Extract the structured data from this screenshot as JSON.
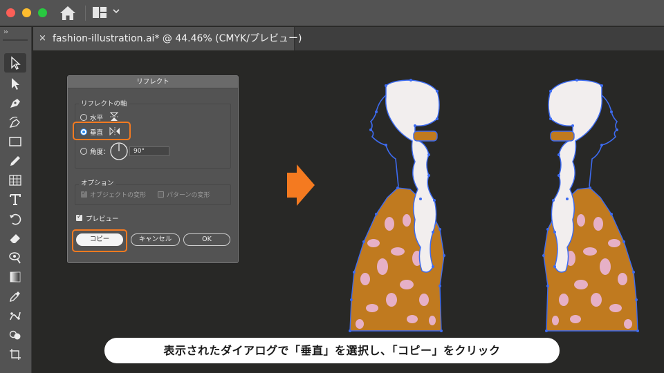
{
  "window": {
    "tab_close_glyph": "×",
    "tab_title": "fashion-illustration.ai* @ 44.46% (CMYK/プレビュー)"
  },
  "toolbar": {
    "collapse_glyph": "››",
    "tools": [
      "selection-tool",
      "direct-selection-tool",
      "pen-tool",
      "curvature-tool",
      "rectangle-tool",
      "pencil-tool",
      "grid-tool",
      "type-tool",
      "rotate-tool",
      "eraser-tool",
      "zoom-tool",
      "gradient-tool",
      "eyedropper-tool",
      "puppet-warp-tool",
      "shape-builder-tool",
      "artboard-tool"
    ]
  },
  "dialog": {
    "title": "リフレクト",
    "axis_group_label": "リフレクトの軸",
    "horizontal_label": "水平",
    "vertical_label": "垂直",
    "angle_label": "角度：",
    "angle_value": "90°",
    "options_group_label": "オプション",
    "transform_objects_label": "オブジェクトの変形",
    "transform_patterns_label": "パターンの変形",
    "preview_label": "プレビュー",
    "copy_button": "コピー",
    "cancel_button": "キャンセル",
    "ok_button": "OK",
    "selected_axis": "垂直",
    "preview_checked": true
  },
  "caption": {
    "text": "表示されたダイアログで「垂直」を選択し、「コピー」をクリック"
  },
  "colors": {
    "highlight": "#f47a20",
    "arrow": "#f47a20",
    "selection_path": "#3d6bf0",
    "dress": "#c07a1f",
    "dress_pattern": "#e6b0c6",
    "hair": "#f2eeee"
  }
}
